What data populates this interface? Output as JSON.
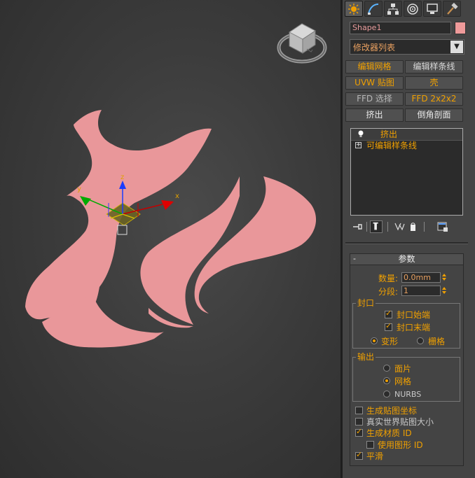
{
  "viewport": {
    "shape_color": "#e9979a",
    "gizmo_axes": {
      "x": "x",
      "y": "y",
      "z": "z"
    }
  },
  "command_panel": {
    "tabs": [
      {
        "icon": "create-sun-icon",
        "active": true
      },
      {
        "icon": "modify-curve-icon",
        "active": false
      },
      {
        "icon": "hierarchy-icon",
        "active": false
      },
      {
        "icon": "motion-icon",
        "active": false
      },
      {
        "icon": "display-monitor-icon",
        "active": false
      },
      {
        "icon": "utilities-hammer-icon",
        "active": false
      }
    ],
    "object_name": "Shape1",
    "object_color": "#ef9a9a",
    "modifier_list": "修改器列表",
    "buttons": [
      {
        "label": "编辑网格"
      },
      {
        "label": "编辑样条线"
      },
      {
        "label": "UVW 贴图"
      },
      {
        "label": "壳"
      },
      {
        "label": "FFD 选择"
      },
      {
        "label": "FFD 2x2x2"
      },
      {
        "label": "挤出"
      },
      {
        "label": "倒角剖面"
      }
    ],
    "stack": [
      {
        "label": "挤出"
      },
      {
        "label": "可编辑样条线"
      }
    ]
  },
  "params": {
    "title": "参数",
    "amount_label": "数量:",
    "amount_value": "0.0mm",
    "segments_label": "分段:",
    "segments_value": "1",
    "capping": {
      "title": "封口",
      "cap_start": "封口始端",
      "cap_end": "封口末端",
      "morph": "变形",
      "grid": "栅格"
    },
    "output": {
      "title": "输出",
      "patch": "面片",
      "mesh": "网格",
      "nurbs": "NURBS"
    },
    "gen_map_coords": "生成贴图坐标",
    "real_world_map": "真实世界贴图大小",
    "gen_mat_ids": "生成材质 ID",
    "use_shape_ids": "使用图形 ID",
    "smooth": "平滑"
  }
}
